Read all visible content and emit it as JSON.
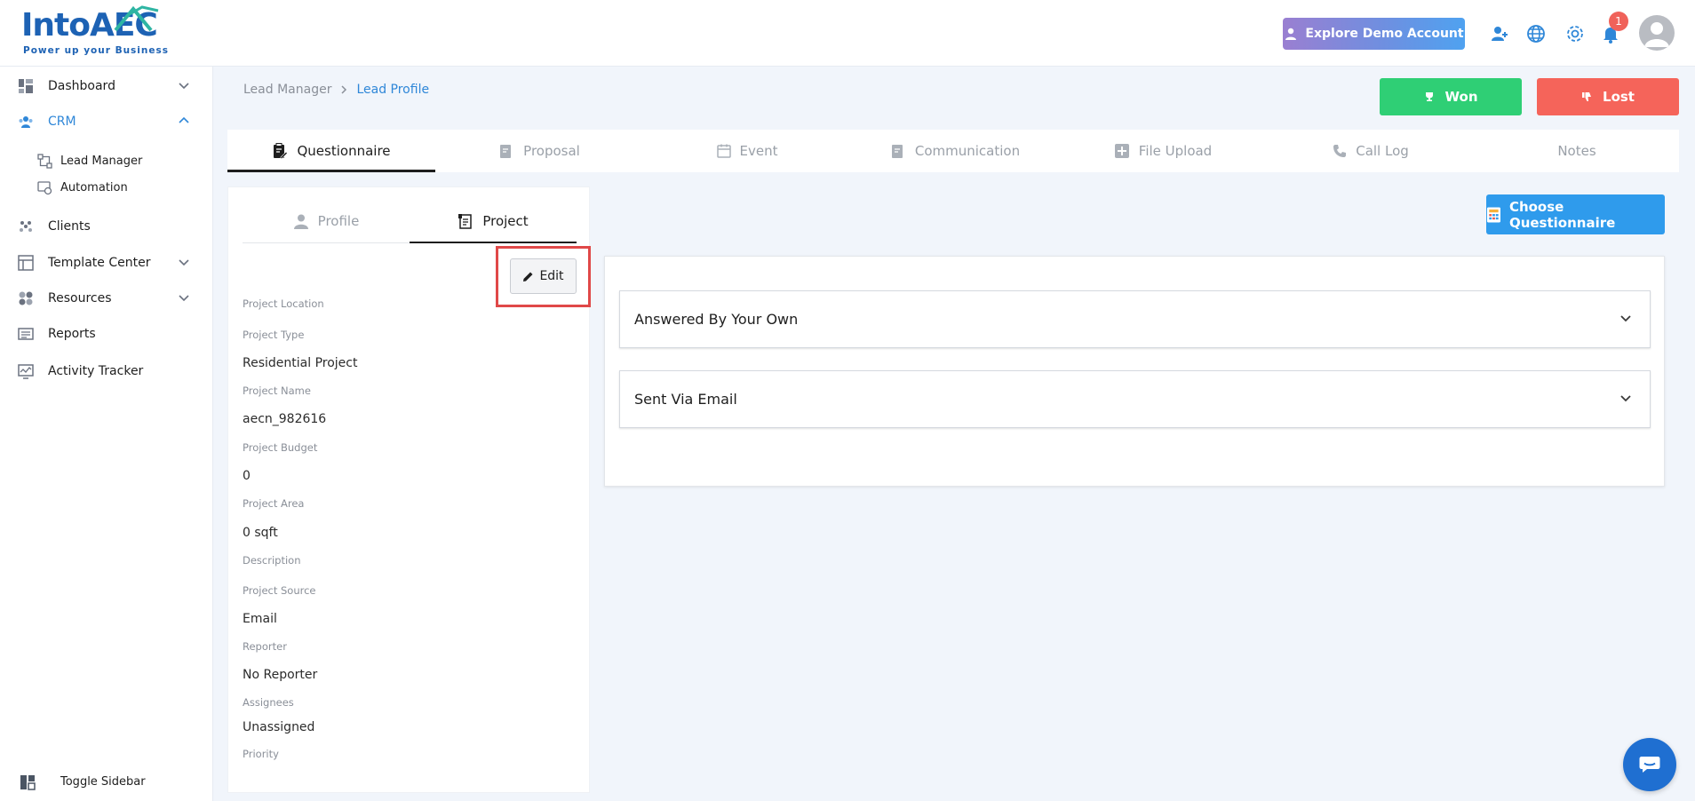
{
  "app": {
    "logo_text_into": "Into",
    "logo_text_aec": "AEC",
    "logo_tagline": "Power up your Business"
  },
  "header": {
    "demo_button": "Explore Demo Account",
    "notification_count": "1",
    "icons": [
      "add-user-icon",
      "globe-icon",
      "gear-icon",
      "bell-icon",
      "avatar"
    ]
  },
  "sidebar": {
    "items": [
      {
        "label": "Dashboard",
        "icon": "dashboard-icon",
        "has_chevron": true
      },
      {
        "label": "CRM",
        "icon": "crm-icon",
        "has_chevron": true,
        "active": true
      },
      {
        "label": "Lead Manager",
        "icon": "lead-manager-icon"
      },
      {
        "label": "Automation",
        "icon": "automation-icon"
      },
      {
        "label": "Clients",
        "icon": "clients-icon"
      },
      {
        "label": "Template Center",
        "icon": "template-icon",
        "has_chevron": true
      },
      {
        "label": "Resources",
        "icon": "resources-icon",
        "has_chevron": true
      },
      {
        "label": "Reports",
        "icon": "reports-icon"
      },
      {
        "label": "Activity Tracker",
        "icon": "activity-icon"
      }
    ],
    "toggle_label": "Toggle Sidebar"
  },
  "breadcrumb": {
    "parent": "Lead Manager",
    "current": "Lead Profile"
  },
  "actions": {
    "won": "Won",
    "lost": "Lost"
  },
  "tabs": [
    {
      "label": "Questionnaire",
      "active": true
    },
    {
      "label": "Proposal"
    },
    {
      "label": "Event"
    },
    {
      "label": "Communication"
    },
    {
      "label": "File Upload"
    },
    {
      "label": "Call Log"
    },
    {
      "label": "Notes"
    }
  ],
  "left_panel": {
    "subtabs": {
      "profile": "Profile",
      "project": "Project"
    },
    "edit_button": "Edit",
    "fields": [
      {
        "label": "Project Location",
        "value": ""
      },
      {
        "label": "Project Type",
        "value": "Residential Project"
      },
      {
        "label": "Project Name",
        "value": "aecn_982616"
      },
      {
        "label": "Project Budget",
        "value": "0"
      },
      {
        "label": "Project Area",
        "value": "0 sqft"
      },
      {
        "label": "Description",
        "value": ""
      },
      {
        "label": "Project Source",
        "value": "Email"
      },
      {
        "label": "Reporter",
        "value": "No Reporter"
      },
      {
        "label": "Assignees",
        "value": "Unassigned"
      },
      {
        "label": "Priority",
        "value": ""
      }
    ]
  },
  "questionnaire": {
    "choose_button": "Choose Questionnaire",
    "sections": [
      {
        "title": "Answered By Your Own"
      },
      {
        "title": "Sent Via Email"
      }
    ]
  },
  "colors": {
    "primary_blue": "#2f87d8",
    "won_green": "#2fcf75",
    "lost_red": "#f5645a",
    "highlight_red": "#e04848"
  }
}
